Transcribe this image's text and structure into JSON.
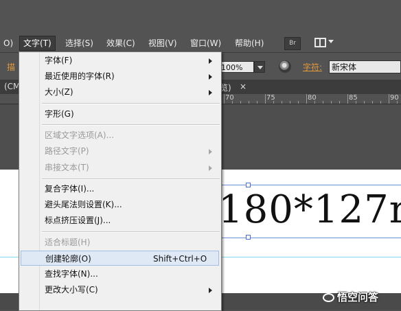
{
  "menubar": {
    "items": [
      {
        "label": "O)"
      },
      {
        "label": "文字(T)"
      },
      {
        "label": "选择(S)"
      },
      {
        "label": "效果(C)"
      },
      {
        "label": "视图(V)"
      },
      {
        "label": "窗口(W)"
      },
      {
        "label": "帮助(H)"
      }
    ],
    "br_label": "Br"
  },
  "control": {
    "left_label": "描",
    "zoom": "100%",
    "char_label": "字符:",
    "font_value": "新宋体"
  },
  "tabs": {
    "left": "(CM",
    "right": "览)",
    "close": "×"
  },
  "ruler": {
    "labels": [
      "70",
      "75",
      "80",
      "85",
      "90"
    ]
  },
  "canvas": {
    "big_text": "180*127r"
  },
  "dropdown": {
    "items": [
      {
        "label": "字体(F)",
        "submenu": true,
        "disabled": false
      },
      {
        "label": "最近使用的字体(R)",
        "submenu": true,
        "disabled": false
      },
      {
        "label": "大小(Z)",
        "submenu": true,
        "disabled": false
      },
      {
        "label": "字形(G)",
        "submenu": false,
        "disabled": false
      },
      {
        "label": "区域文字选项(A)...",
        "submenu": false,
        "disabled": true
      },
      {
        "label": "路径文字(P)",
        "submenu": true,
        "disabled": true
      },
      {
        "label": "串接文本(T)",
        "submenu": true,
        "disabled": true
      },
      {
        "label": "复合字体(I)...",
        "submenu": false,
        "disabled": false
      },
      {
        "label": "避头尾法则设置(K)...",
        "submenu": false,
        "disabled": false
      },
      {
        "label": "标点挤压设置(J)...",
        "submenu": false,
        "disabled": false
      },
      {
        "label": "适合标题(H)",
        "submenu": false,
        "disabled": true
      },
      {
        "label": "创建轮廓(O)",
        "shortcut": "Shift+Ctrl+O",
        "submenu": false,
        "disabled": false,
        "highlighted": true
      },
      {
        "label": "查找字体(N)...",
        "submenu": false,
        "disabled": false
      },
      {
        "label": "更改大小写(C)",
        "submenu": true,
        "disabled": false
      }
    ]
  },
  "watermark": {
    "text": "悟空问答"
  }
}
